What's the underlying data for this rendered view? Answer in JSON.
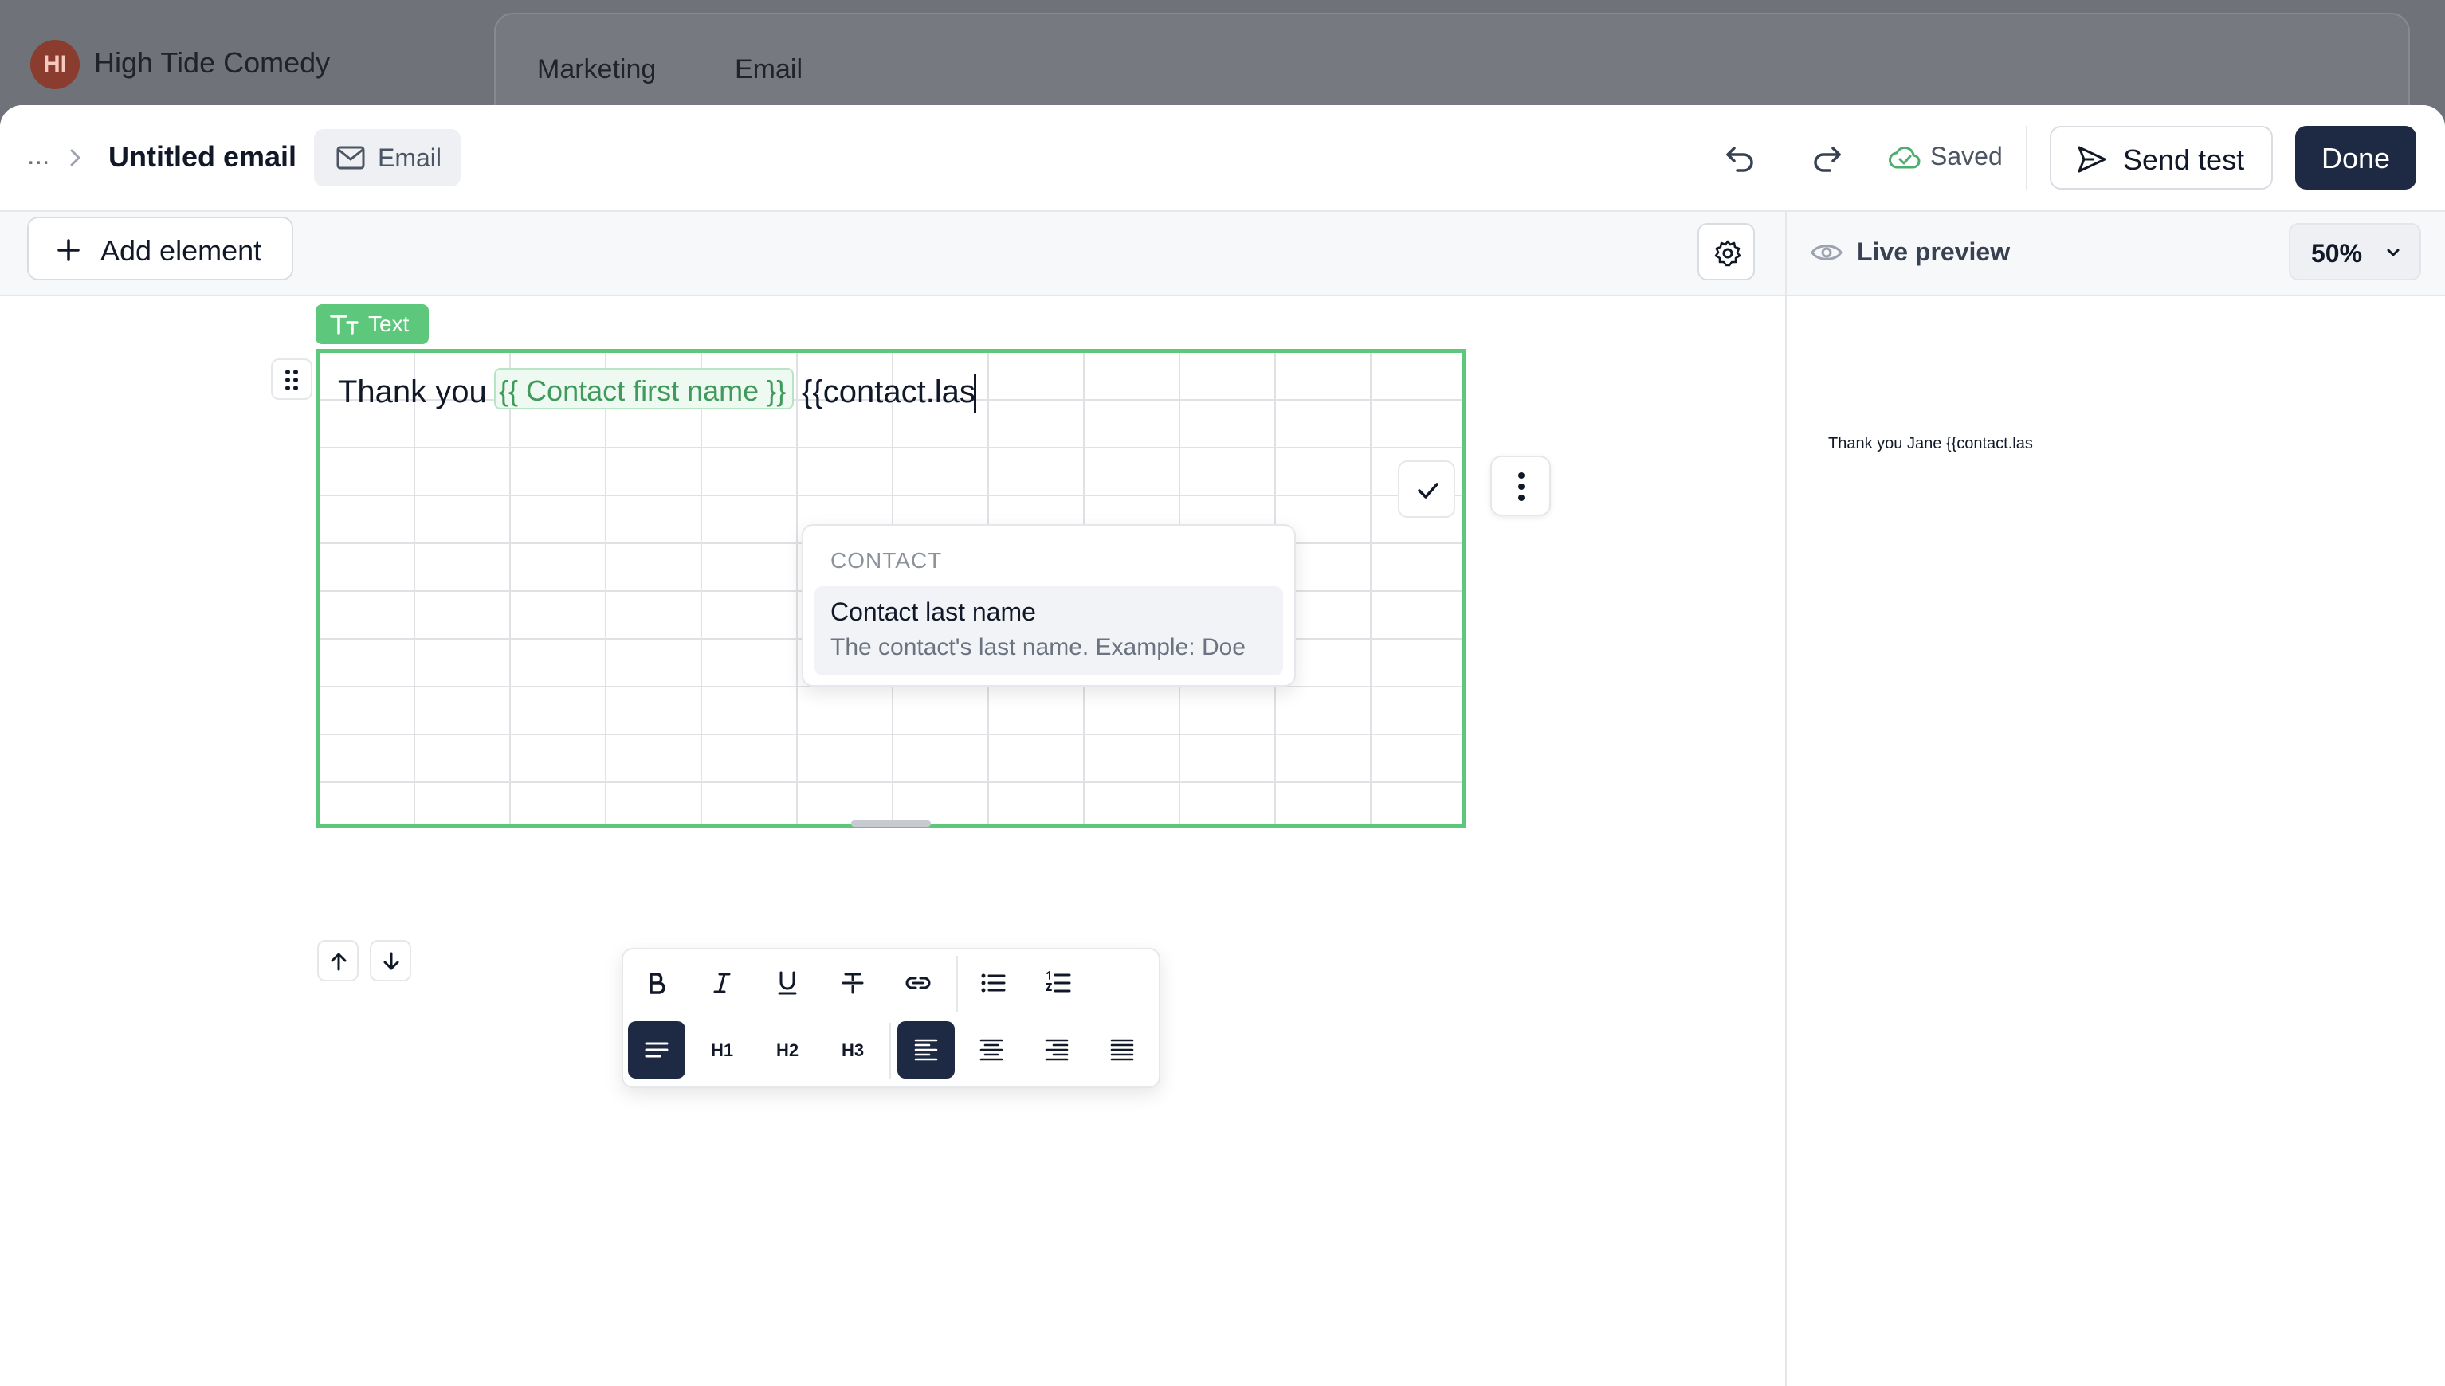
{
  "background_app": {
    "org_initials": "HI",
    "org_name": "High Tide Comedy",
    "tab_1": "Marketing",
    "tab_2": "Email"
  },
  "header": {
    "breadcrumb_more": "...",
    "title": "Untitled email",
    "type_badge": "Email",
    "saved_label": "Saved",
    "send_test_label": "Send test",
    "done_label": "Done"
  },
  "toolbar": {
    "add_element_label": "Add element"
  },
  "editor": {
    "block_tag": "Text",
    "text_prefix": "Thank you",
    "merge_tag_chip": "{{ Contact first name }}",
    "typed_text": "{{contact.las"
  },
  "suggestions": {
    "group_label": "CONTACT",
    "item_title": "Contact last name",
    "item_description": "The contact's last name. Example: Doe"
  },
  "format_toolbar": {
    "h1": "H1",
    "h2": "H2",
    "h3": "H3"
  },
  "preview": {
    "label": "Live preview",
    "zoom": "50%",
    "content": "Thank you Jane {{contact.las"
  },
  "colors": {
    "accent_green": "#5dc77c",
    "primary_dark": "#1e2a44"
  }
}
